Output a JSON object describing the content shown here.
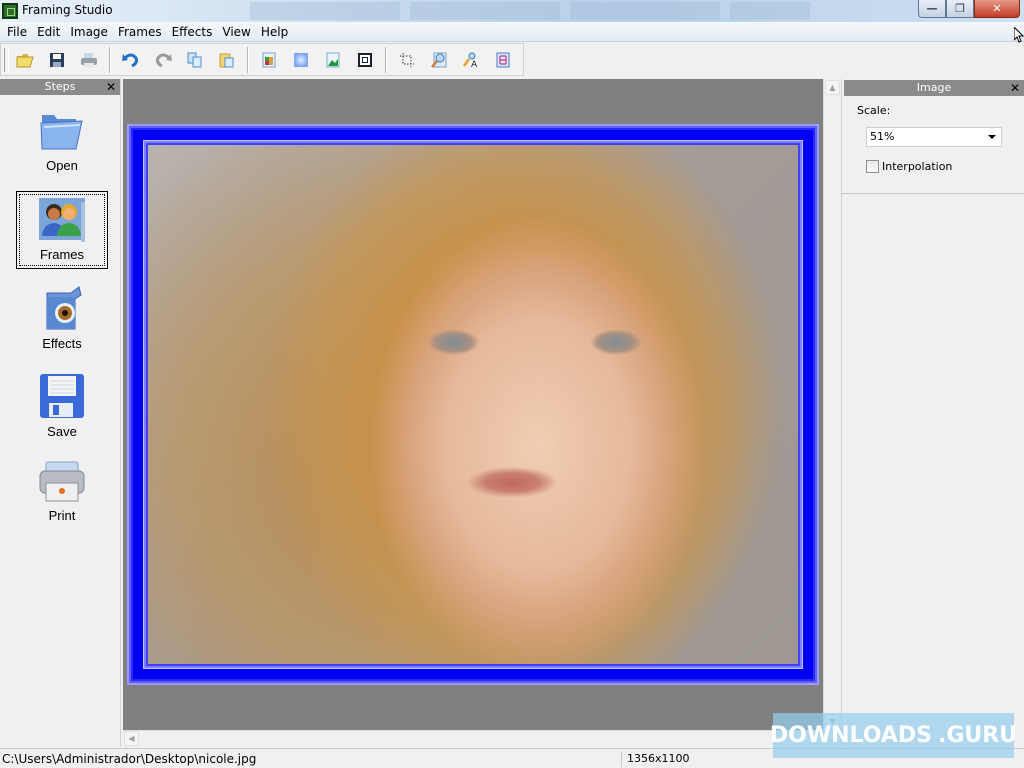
{
  "window": {
    "title": "Framing Studio",
    "controls": {
      "minimize": "—",
      "restore": "❐",
      "close": "✕"
    }
  },
  "menu": {
    "items": [
      "File",
      "Edit",
      "Image",
      "Frames",
      "Effects",
      "View",
      "Help"
    ]
  },
  "toolbar": {
    "buttons": [
      {
        "name": "open",
        "icon": "folder-open-icon"
      },
      {
        "name": "save",
        "icon": "floppy-disk-icon"
      },
      {
        "name": "print",
        "icon": "printer-icon"
      },
      {
        "name": "undo",
        "icon": "undo-icon"
      },
      {
        "name": "redo",
        "icon": "redo-icon",
        "disabled": true
      },
      {
        "name": "copy",
        "icon": "copy-icon"
      },
      {
        "name": "paste",
        "icon": "paste-icon"
      },
      {
        "name": "frames",
        "icon": "frames-icon"
      },
      {
        "name": "effects",
        "icon": "effects-icon"
      },
      {
        "name": "image",
        "icon": "image-icon"
      },
      {
        "name": "border",
        "icon": "border-icon"
      },
      {
        "name": "crop",
        "icon": "crop-icon"
      },
      {
        "name": "zoom",
        "icon": "zoom-icon"
      },
      {
        "name": "text",
        "icon": "text-icon"
      },
      {
        "name": "layout",
        "icon": "layout-icon"
      }
    ]
  },
  "steps_panel": {
    "title": "Steps",
    "close": "✕",
    "items": [
      {
        "label": "Open",
        "icon": "folder-icon",
        "selected": false
      },
      {
        "label": "Frames",
        "icon": "users-icon",
        "selected": true
      },
      {
        "label": "Effects",
        "icon": "effects-box-icon",
        "selected": false
      },
      {
        "label": "Save",
        "icon": "floppy-disk-icon",
        "selected": false
      },
      {
        "label": "Print",
        "icon": "printer-icon",
        "selected": false
      }
    ]
  },
  "canvas": {
    "frame_color": "#0000f2",
    "background": "#808080"
  },
  "image_panel": {
    "title": "Image",
    "close": "✕",
    "scale_label": "Scale:",
    "scale_value": "51%",
    "interpolation_label": "Interpolation",
    "interpolation_checked": false
  },
  "status": {
    "path": "C:\\Users\\Administrador\\Desktop\\nicole.jpg",
    "dimensions": "1356x1100"
  },
  "watermark": {
    "left": "DOWNLOADS",
    "right": ".GURU"
  }
}
